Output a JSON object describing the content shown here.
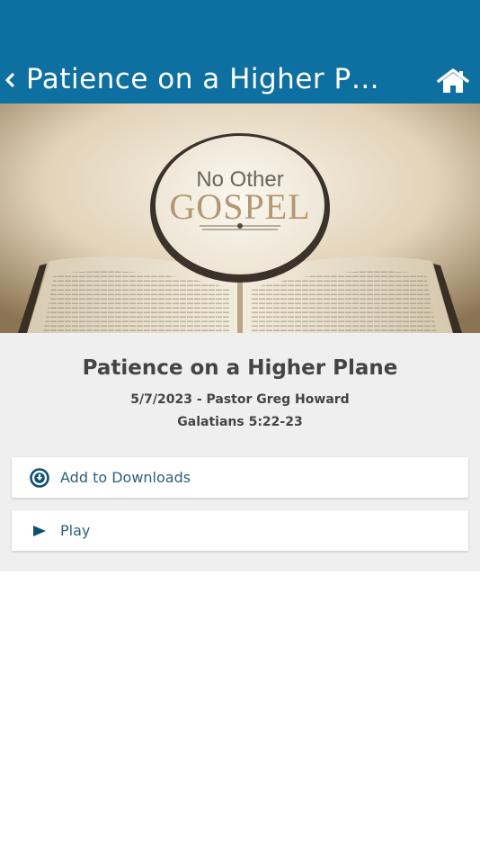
{
  "header": {
    "title": "Patience on a Higher Pl…",
    "back_icon": "chevron-left-icon",
    "home_icon": "home-icon",
    "background": "#0e70a0"
  },
  "hero": {
    "line1": "No Other",
    "line2": "GOSPEL"
  },
  "sermon": {
    "title": "Patience on a Higher Plane",
    "date_speaker": "5/7/2023 - Pastor Greg Howard",
    "scripture": "Galatians 5:22-23"
  },
  "actions": {
    "downloads_label": "Add to Downloads",
    "downloads_icon": "download-circle-icon",
    "play_label": "Play",
    "play_icon": "play-icon",
    "accent": "#0e4f74"
  }
}
